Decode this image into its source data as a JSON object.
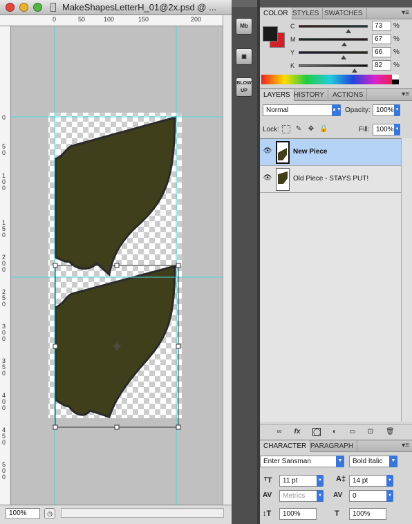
{
  "window": {
    "title": "MakeShapesLetterH_01@2x.psd @ ..."
  },
  "ruler": {
    "top_labels": [
      "0",
      "50",
      "100",
      "150",
      "200"
    ],
    "left_labels": [
      "0",
      "5 0",
      "1 0 0",
      "1 5 0",
      "2 0 0",
      "2 5 0",
      "3 0 0",
      "3 5 0",
      "4 0 0",
      "4 5 0",
      "5 0 0"
    ]
  },
  "status": {
    "zoom": "100%"
  },
  "dock": {
    "items": [
      {
        "label": "Mb",
        "icon": "mini-bridge-icon"
      },
      {
        "label": "",
        "icon": "photo-icon"
      },
      {
        "label": "BLOW UP",
        "icon": "blowup-icon"
      }
    ]
  },
  "color_panel": {
    "tabs": [
      "COLOR",
      "STYLES",
      "SWATCHES"
    ],
    "foreground": "#1a1a1a",
    "background": "#d1202a",
    "channels": [
      {
        "label": "C",
        "value": "73",
        "unit": "%"
      },
      {
        "label": "M",
        "value": "67",
        "unit": "%"
      },
      {
        "label": "Y",
        "value": "66",
        "unit": "%"
      },
      {
        "label": "K",
        "value": "82",
        "unit": "%"
      }
    ]
  },
  "layers_panel": {
    "tabs": [
      "LAYERS",
      "HISTORY",
      "ACTIONS"
    ],
    "blend_mode": "Normal",
    "opacity_label": "Opacity:",
    "opacity": "100%",
    "lock_label": "Lock:",
    "fill_label": "Fill:",
    "fill": "100%",
    "layers": [
      {
        "name": "New Piece",
        "selected": true
      },
      {
        "name": "Old Piece - STAYS PUT!",
        "selected": false
      }
    ]
  },
  "character_panel": {
    "tabs": [
      "CHARACTER",
      "PARAGRAPH"
    ],
    "font_family": "Enter Sansman",
    "font_style": "Bold Italic",
    "font_size": "11 pt",
    "leading": "14 pt",
    "kerning": "Metrics",
    "tracking": "0",
    "vertical_scale": "100%",
    "horizontal_scale": "100%"
  },
  "colors": {
    "shape_fill": "#3f3f1c",
    "guide": "#49d8e0",
    "selection_blue": "#b5d3f7"
  }
}
